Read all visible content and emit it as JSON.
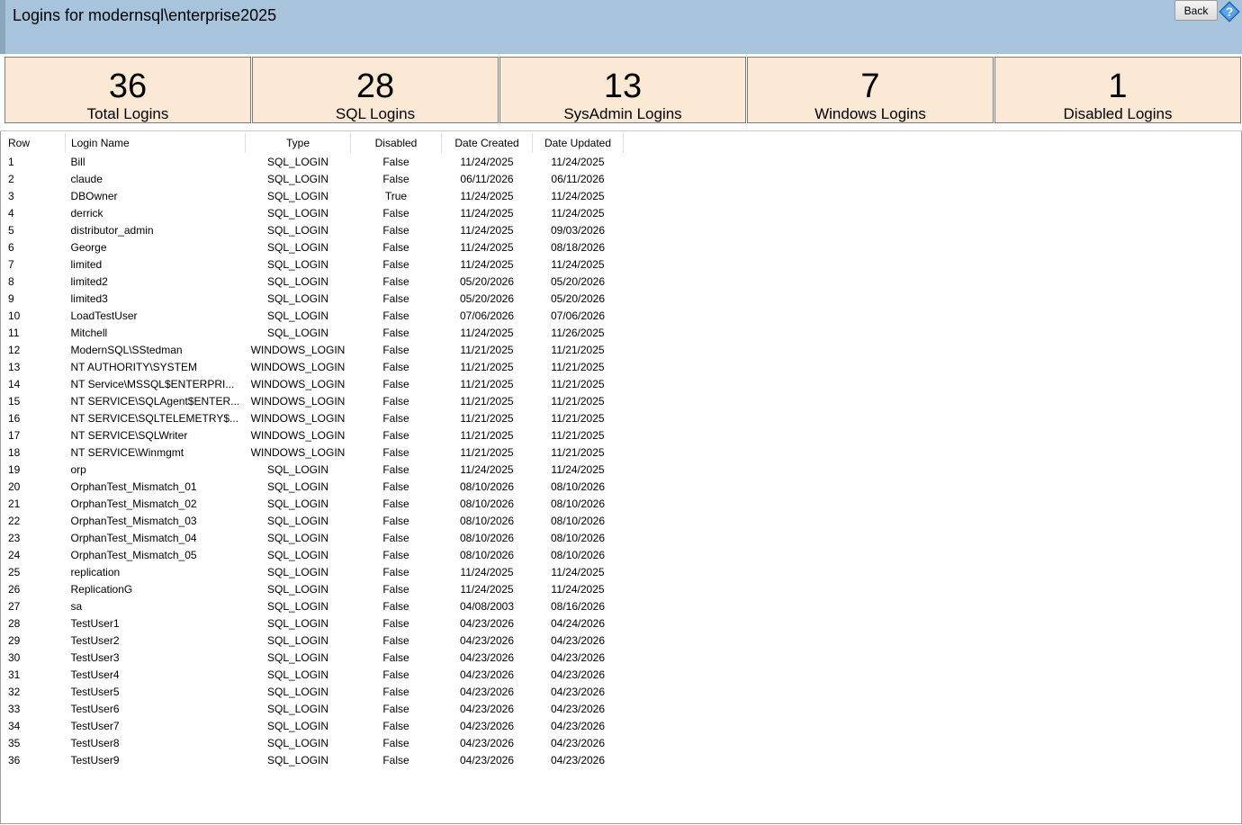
{
  "header": {
    "title": "Logins for modernsql\\enterprise2025",
    "back_label": "Back",
    "help_icon": "help-question-icon"
  },
  "tiles": [
    {
      "value": "36",
      "label": "Total Logins"
    },
    {
      "value": "28",
      "label": "SQL Logins"
    },
    {
      "value": "13",
      "label": "SysAdmin Logins"
    },
    {
      "value": "7",
      "label": "Windows Logins"
    },
    {
      "value": "1",
      "label": "Disabled Logins"
    }
  ],
  "table": {
    "columns": [
      "Row",
      "Login Name",
      "Type",
      "Disabled",
      "Date Created",
      "Date Updated"
    ],
    "rows": [
      [
        "1",
        "Bill",
        "SQL_LOGIN",
        "False",
        "11/24/2025",
        "11/24/2025"
      ],
      [
        "2",
        "claude",
        "SQL_LOGIN",
        "False",
        "06/11/2026",
        "06/11/2026"
      ],
      [
        "3",
        "DBOwner",
        "SQL_LOGIN",
        "True",
        "11/24/2025",
        "11/24/2025"
      ],
      [
        "4",
        "derrick",
        "SQL_LOGIN",
        "False",
        "11/24/2025",
        "11/24/2025"
      ],
      [
        "5",
        "distributor_admin",
        "SQL_LOGIN",
        "False",
        "11/24/2025",
        "09/03/2026"
      ],
      [
        "6",
        "George",
        "SQL_LOGIN",
        "False",
        "11/24/2025",
        "08/18/2026"
      ],
      [
        "7",
        "limited",
        "SQL_LOGIN",
        "False",
        "11/24/2025",
        "11/24/2025"
      ],
      [
        "8",
        "limited2",
        "SQL_LOGIN",
        "False",
        "05/20/2026",
        "05/20/2026"
      ],
      [
        "9",
        "limited3",
        "SQL_LOGIN",
        "False",
        "05/20/2026",
        "05/20/2026"
      ],
      [
        "10",
        "LoadTestUser",
        "SQL_LOGIN",
        "False",
        "07/06/2026",
        "07/06/2026"
      ],
      [
        "11",
        "Mitchell",
        "SQL_LOGIN",
        "False",
        "11/24/2025",
        "11/26/2025"
      ],
      [
        "12",
        "ModernSQL\\SStedman",
        "WINDOWS_LOGIN",
        "False",
        "11/21/2025",
        "11/21/2025"
      ],
      [
        "13",
        "NT AUTHORITY\\SYSTEM",
        "WINDOWS_LOGIN",
        "False",
        "11/21/2025",
        "11/21/2025"
      ],
      [
        "14",
        "NT Service\\MSSQL$ENTERPRI...",
        "WINDOWS_LOGIN",
        "False",
        "11/21/2025",
        "11/21/2025"
      ],
      [
        "15",
        "NT SERVICE\\SQLAgent$ENTER...",
        "WINDOWS_LOGIN",
        "False",
        "11/21/2025",
        "11/21/2025"
      ],
      [
        "16",
        "NT SERVICE\\SQLTELEMETRY$...",
        "WINDOWS_LOGIN",
        "False",
        "11/21/2025",
        "11/21/2025"
      ],
      [
        "17",
        "NT SERVICE\\SQLWriter",
        "WINDOWS_LOGIN",
        "False",
        "11/21/2025",
        "11/21/2025"
      ],
      [
        "18",
        "NT SERVICE\\Winmgmt",
        "WINDOWS_LOGIN",
        "False",
        "11/21/2025",
        "11/21/2025"
      ],
      [
        "19",
        "orp",
        "SQL_LOGIN",
        "False",
        "11/24/2025",
        "11/24/2025"
      ],
      [
        "20",
        "OrphanTest_Mismatch_01",
        "SQL_LOGIN",
        "False",
        "08/10/2026",
        "08/10/2026"
      ],
      [
        "21",
        "OrphanTest_Mismatch_02",
        "SQL_LOGIN",
        "False",
        "08/10/2026",
        "08/10/2026"
      ],
      [
        "22",
        "OrphanTest_Mismatch_03",
        "SQL_LOGIN",
        "False",
        "08/10/2026",
        "08/10/2026"
      ],
      [
        "23",
        "OrphanTest_Mismatch_04",
        "SQL_LOGIN",
        "False",
        "08/10/2026",
        "08/10/2026"
      ],
      [
        "24",
        "OrphanTest_Mismatch_05",
        "SQL_LOGIN",
        "False",
        "08/10/2026",
        "08/10/2026"
      ],
      [
        "25",
        "replication",
        "SQL_LOGIN",
        "False",
        "11/24/2025",
        "11/24/2025"
      ],
      [
        "26",
        "ReplicationG",
        "SQL_LOGIN",
        "False",
        "11/24/2025",
        "11/24/2025"
      ],
      [
        "27",
        "sa",
        "SQL_LOGIN",
        "False",
        "04/08/2003",
        "08/16/2026"
      ],
      [
        "28",
        "TestUser1",
        "SQL_LOGIN",
        "False",
        "04/23/2026",
        "04/24/2026"
      ],
      [
        "29",
        "TestUser2",
        "SQL_LOGIN",
        "False",
        "04/23/2026",
        "04/23/2026"
      ],
      [
        "30",
        "TestUser3",
        "SQL_LOGIN",
        "False",
        "04/23/2026",
        "04/23/2026"
      ],
      [
        "31",
        "TestUser4",
        "SQL_LOGIN",
        "False",
        "04/23/2026",
        "04/23/2026"
      ],
      [
        "32",
        "TestUser5",
        "SQL_LOGIN",
        "False",
        "04/23/2026",
        "04/23/2026"
      ],
      [
        "33",
        "TestUser6",
        "SQL_LOGIN",
        "False",
        "04/23/2026",
        "04/23/2026"
      ],
      [
        "34",
        "TestUser7",
        "SQL_LOGIN",
        "False",
        "04/23/2026",
        "04/23/2026"
      ],
      [
        "35",
        "TestUser8",
        "SQL_LOGIN",
        "False",
        "04/23/2026",
        "04/23/2026"
      ],
      [
        "36",
        "TestUser9",
        "SQL_LOGIN",
        "False",
        "04/23/2026",
        "04/23/2026"
      ]
    ]
  },
  "colors": {
    "header_bg": "#a7c4dc",
    "tile_bg": "#fbe8d5",
    "tile_border": "#7a7a7a"
  }
}
